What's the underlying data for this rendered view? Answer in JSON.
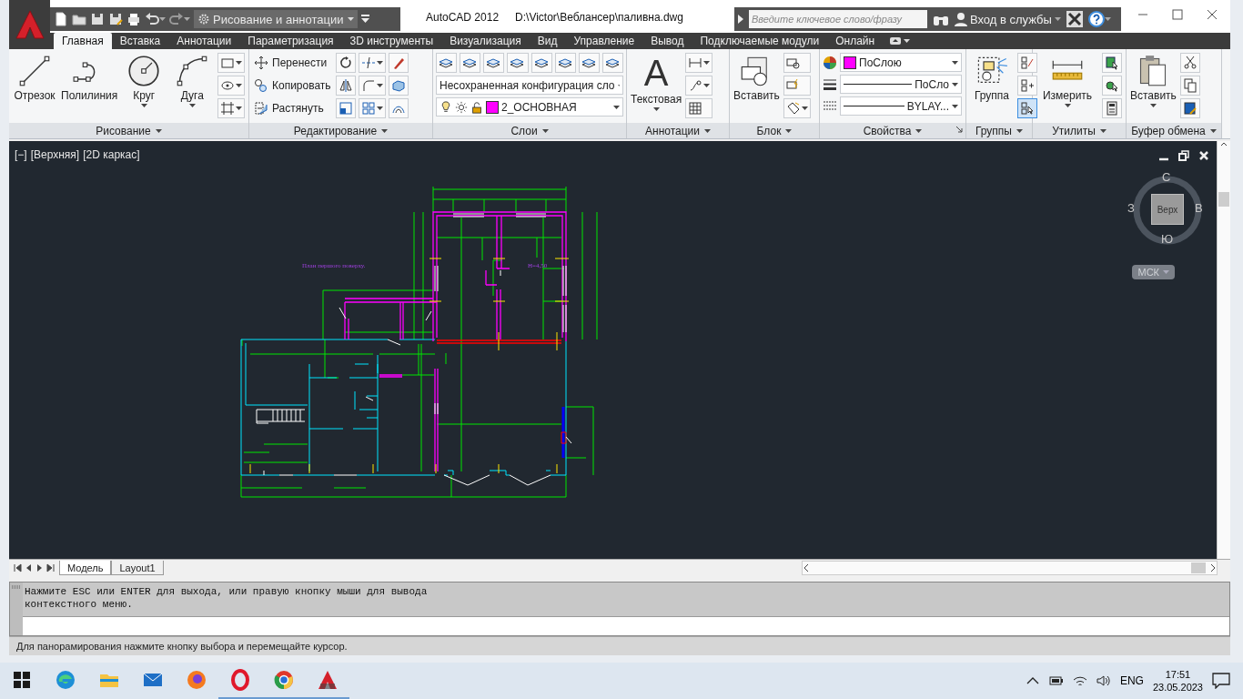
{
  "quick_access": {
    "workspace": "Рисование и аннотации"
  },
  "title": {
    "app": "AutoCAD 2012",
    "file": "D:\\Victor\\Веблансер\\паливна.dwg"
  },
  "infocenter": {
    "search_placeholder": "Введите ключевое слово/фразу",
    "sign_in": "Вход в службы"
  },
  "tabs": [
    {
      "label": "Главная",
      "selected": true
    },
    {
      "label": "Вставка",
      "selected": false
    },
    {
      "label": "Аннотации",
      "selected": false
    },
    {
      "label": "Параметризация",
      "selected": false
    },
    {
      "label": "3D инструменты",
      "selected": false
    },
    {
      "label": "Визуализация",
      "selected": false
    },
    {
      "label": "Вид",
      "selected": false
    },
    {
      "label": "Управление",
      "selected": false
    },
    {
      "label": "Вывод",
      "selected": false
    },
    {
      "label": "Подключаемые модули",
      "selected": false
    },
    {
      "label": "Онлайн",
      "selected": false
    }
  ],
  "panels": [
    {
      "kind": "draw",
      "title": "Рисование",
      "tools": [
        {
          "label": "Отрезок",
          "dropdown": false
        },
        {
          "label": "Полилиния",
          "dropdown": false
        },
        {
          "label": "Круг",
          "dropdown": true
        },
        {
          "label": "Дуга",
          "dropdown": true
        }
      ]
    },
    {
      "kind": "modify",
      "title": "Редактирование",
      "tools": [
        {
          "label": "Перенести"
        },
        {
          "label": "Копировать"
        },
        {
          "label": "Растянуть"
        }
      ]
    },
    {
      "kind": "layers",
      "title": "Слои",
      "config": "Несохраненная конфигурация сло",
      "layer": {
        "name": "2_ОСНОВНАЯ",
        "color": "#ff00ff"
      }
    },
    {
      "kind": "annotation",
      "title": "Аннотации",
      "tools": [
        {
          "label": "Текстовая",
          "icon_char": "A",
          "dropdown": true
        }
      ]
    },
    {
      "kind": "block",
      "title": "Блок",
      "tools": [
        {
          "label": "Вставить",
          "dropdown": false
        }
      ]
    },
    {
      "kind": "properties",
      "title": "Свойства",
      "color": {
        "label": "ПоСлою",
        "color": "#ff00ff"
      },
      "lineweight": "ПоСло",
      "linetype": "BYLAY..."
    },
    {
      "kind": "groups",
      "title": "Группы",
      "tools": [
        {
          "label": "Группа",
          "dropdown": false
        }
      ],
      "selection_toggle": {
        "on": true
      }
    },
    {
      "kind": "utilities",
      "title": "Утилиты",
      "tools": [
        {
          "label": "Измерить",
          "dropdown": true
        }
      ]
    },
    {
      "kind": "clipboard",
      "title": "Буфер обмена",
      "tools": [
        {
          "label": "Вставить",
          "dropdown": true
        }
      ]
    }
  ],
  "viewport": {
    "controls": [
      "[−]",
      "[Верхняя]",
      "[2D каркас]"
    ],
    "drawing_labels": [
      "План першого поверху.",
      "Н=4,50"
    ],
    "viewcube": {
      "face": "Верх",
      "north": "С",
      "east": "В",
      "south": "Ю",
      "west": "З",
      "ucs": "МСК"
    }
  },
  "layout_tabs": [
    {
      "label": "Модель",
      "selected": true
    },
    {
      "label": "Layout1",
      "selected": false
    }
  ],
  "command_history": [
    "Нажмите ESC или ENTER для выхода, или правую кнопку мыши для вывода",
    "контекстного меню."
  ],
  "status_bar": "Для панорамирования нажмите кнопку выбора и перемещайте курсор.",
  "taskbar": {
    "apps": [
      {
        "open": false
      },
      {
        "open": false
      },
      {
        "open": false
      },
      {
        "open": false
      },
      {
        "open": true
      },
      {
        "open": true
      },
      {
        "open": true
      }
    ],
    "language": "ENG",
    "time": "17:51",
    "date": "23.05.2023"
  }
}
